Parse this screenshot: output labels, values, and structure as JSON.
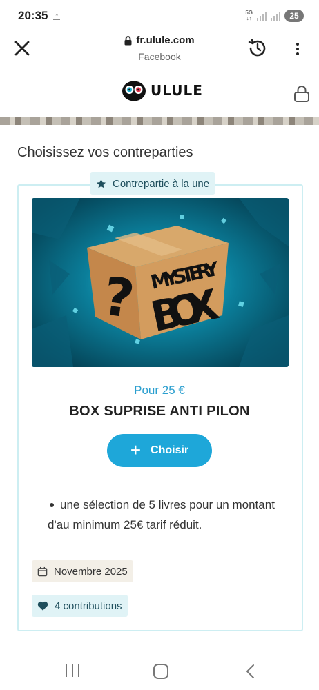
{
  "status_bar": {
    "time": "20:35",
    "network": "5G",
    "battery": "25"
  },
  "browser": {
    "domain": "fr.ulule.com",
    "source": "Facebook"
  },
  "site": {
    "logo_text": "ULULE"
  },
  "rewards_section": {
    "title": "Choisissez vos contreparties",
    "featured_badge": "Contrepartie à la une",
    "reward": {
      "image_text_line1": "MYSTERY",
      "image_text_line2": "BOX",
      "image_symbol": "?",
      "price": "Pour 25 €",
      "name": "BOX SUPRISE ANTI PILON",
      "choose_label": "Choisir",
      "description": "une sélection de 5 livres pour un montant d'au minimum 25€ tarif réduit.",
      "delivery_date": "Novembre 2025",
      "contributions": "4 contributions"
    }
  },
  "colors": {
    "accent": "#1ea7d9",
    "price": "#2b9fcf",
    "badge_bg": "#e0f3f6",
    "card_border": "#cdeef2"
  },
  "icons": [
    "close-icon",
    "padlock-icon",
    "history-icon",
    "more-vert-icon",
    "lock-icon",
    "star-icon",
    "plus-icon",
    "calendar-icon",
    "heart-icon"
  ]
}
